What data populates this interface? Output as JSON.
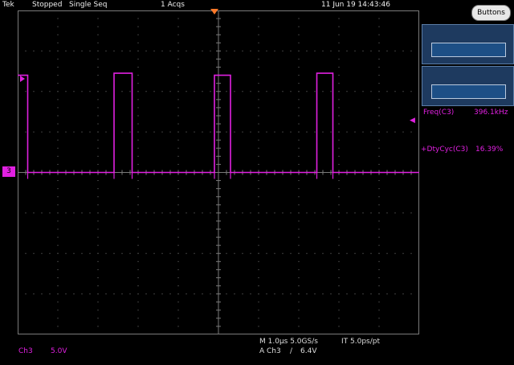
{
  "header": {
    "brand": "Tek",
    "state": "Stopped",
    "mode": "Single Seq",
    "acqs": "1 Acqs",
    "timestamp": "11 Jun 19 14:43:46"
  },
  "buttons_label": "Buttons",
  "measurements": [
    {
      "label": "Freq(C3)",
      "value": "396.1kHz"
    },
    {
      "label": "+DtyCyc(C3)",
      "value": "16.39%"
    }
  ],
  "channel": {
    "marker": "3",
    "name": "Ch3",
    "scale": "5.0V"
  },
  "timebase": {
    "line1": "M 1.0µs 5.0GS/s",
    "line2": "IT 5.0ps/pt"
  },
  "trigger": {
    "source": "A Ch3",
    "slope": "∕",
    "level": "6.4V"
  },
  "colors": {
    "trace": "#e020e0",
    "grid": "#7a7a7a",
    "panel": "#1e3a5f",
    "orange": "#ff7a2a"
  },
  "chart_data": {
    "type": "line",
    "title": "",
    "xlabel": "",
    "ylabel": "",
    "x_divisions": 10,
    "y_divisions": 8,
    "x_unit_per_div": "1.0µs",
    "y_unit_per_div": "5.0V",
    "xlim": [
      0,
      10
    ],
    "ylim": [
      -4,
      4
    ],
    "grid": true,
    "series": [
      {
        "name": "",
        "x": [
          0,
          0.25,
          0.25,
          2.4,
          2.4,
          2.85,
          2.85,
          4.9,
          4.9,
          5.3,
          5.3,
          7.45,
          7.45,
          7.85,
          7.85,
          10
        ],
        "y": [
          2.4,
          2.4,
          0,
          0,
          2.45,
          2.45,
          0,
          0,
          2.4,
          2.4,
          0,
          0,
          2.45,
          2.45,
          0,
          0
        ]
      }
    ]
  }
}
